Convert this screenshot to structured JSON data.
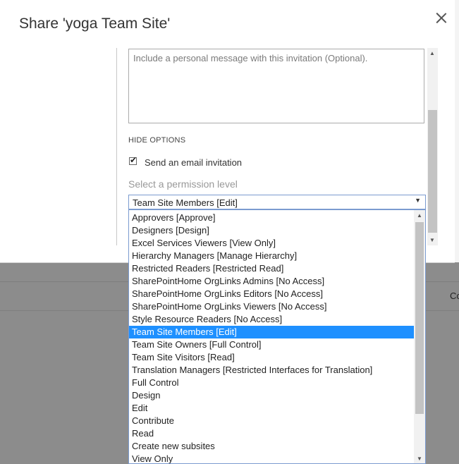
{
  "dialog": {
    "title": "Share 'yoga Team Site'"
  },
  "message": {
    "placeholder": "Include a personal message with this invitation (Optional)."
  },
  "options": {
    "hide_label": "HIDE OPTIONS",
    "send_email_label": "Send an email invitation",
    "send_email_checked": true
  },
  "permission": {
    "label": "Select a permission level",
    "selected": "Team Site Members [Edit]",
    "items": [
      "Approvers [Approve]",
      "Designers [Design]",
      "Excel Services Viewers [View Only]",
      "Hierarchy Managers [Manage Hierarchy]",
      "Restricted Readers [Restricted Read]",
      "SharePointHome OrgLinks Admins [No Access]",
      "SharePointHome OrgLinks Editors [No Access]",
      "SharePointHome OrgLinks Viewers [No Access]",
      "Style Resource Readers [No Access]",
      "Team Site Members [Edit]",
      "Team Site Owners [Full Control]",
      "Team Site Visitors [Read]",
      "Translation Managers [Restricted Interfaces for Translation]",
      "Full Control",
      "Design",
      "Edit",
      "Contribute",
      "Read",
      "Create new subsites",
      "View Only"
    ]
  },
  "background": {
    "partial_text": "Co"
  },
  "icons": {
    "close": "close-icon",
    "dropdown_arrow": "chevron-down-icon",
    "scroll_up": "scroll-up-arrow",
    "scroll_down": "scroll-down-arrow"
  },
  "colors": {
    "selection": "#1e90ff",
    "backdrop": "#8c8c8c",
    "select_border": "#7b9bd0"
  }
}
